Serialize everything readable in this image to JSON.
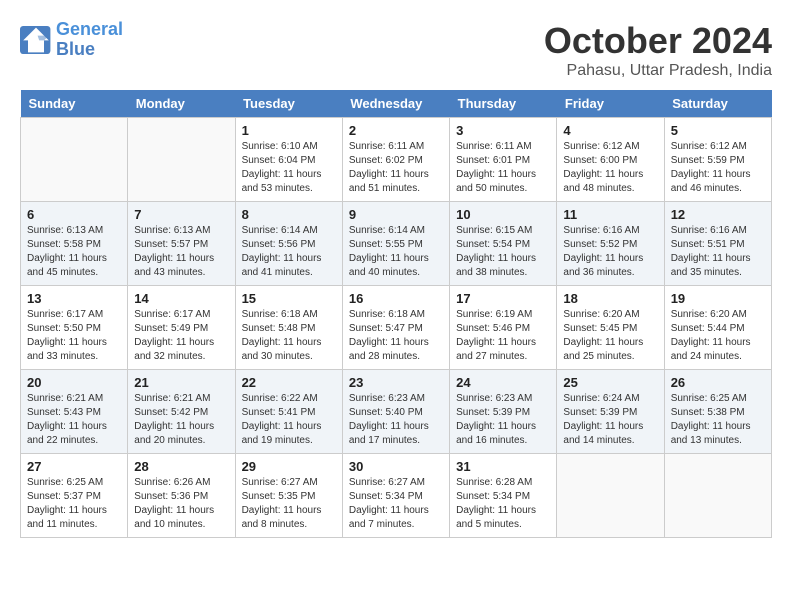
{
  "logo": {
    "line1": "General",
    "line2": "Blue"
  },
  "title": "October 2024",
  "subtitle": "Pahasu, Uttar Pradesh, India",
  "days_header": [
    "Sunday",
    "Monday",
    "Tuesday",
    "Wednesday",
    "Thursday",
    "Friday",
    "Saturday"
  ],
  "weeks": [
    [
      {
        "num": "",
        "info": ""
      },
      {
        "num": "",
        "info": ""
      },
      {
        "num": "1",
        "info": "Sunrise: 6:10 AM\nSunset: 6:04 PM\nDaylight: 11 hours and 53 minutes."
      },
      {
        "num": "2",
        "info": "Sunrise: 6:11 AM\nSunset: 6:02 PM\nDaylight: 11 hours and 51 minutes."
      },
      {
        "num": "3",
        "info": "Sunrise: 6:11 AM\nSunset: 6:01 PM\nDaylight: 11 hours and 50 minutes."
      },
      {
        "num": "4",
        "info": "Sunrise: 6:12 AM\nSunset: 6:00 PM\nDaylight: 11 hours and 48 minutes."
      },
      {
        "num": "5",
        "info": "Sunrise: 6:12 AM\nSunset: 5:59 PM\nDaylight: 11 hours and 46 minutes."
      }
    ],
    [
      {
        "num": "6",
        "info": "Sunrise: 6:13 AM\nSunset: 5:58 PM\nDaylight: 11 hours and 45 minutes."
      },
      {
        "num": "7",
        "info": "Sunrise: 6:13 AM\nSunset: 5:57 PM\nDaylight: 11 hours and 43 minutes."
      },
      {
        "num": "8",
        "info": "Sunrise: 6:14 AM\nSunset: 5:56 PM\nDaylight: 11 hours and 41 minutes."
      },
      {
        "num": "9",
        "info": "Sunrise: 6:14 AM\nSunset: 5:55 PM\nDaylight: 11 hours and 40 minutes."
      },
      {
        "num": "10",
        "info": "Sunrise: 6:15 AM\nSunset: 5:54 PM\nDaylight: 11 hours and 38 minutes."
      },
      {
        "num": "11",
        "info": "Sunrise: 6:16 AM\nSunset: 5:52 PM\nDaylight: 11 hours and 36 minutes."
      },
      {
        "num": "12",
        "info": "Sunrise: 6:16 AM\nSunset: 5:51 PM\nDaylight: 11 hours and 35 minutes."
      }
    ],
    [
      {
        "num": "13",
        "info": "Sunrise: 6:17 AM\nSunset: 5:50 PM\nDaylight: 11 hours and 33 minutes."
      },
      {
        "num": "14",
        "info": "Sunrise: 6:17 AM\nSunset: 5:49 PM\nDaylight: 11 hours and 32 minutes."
      },
      {
        "num": "15",
        "info": "Sunrise: 6:18 AM\nSunset: 5:48 PM\nDaylight: 11 hours and 30 minutes."
      },
      {
        "num": "16",
        "info": "Sunrise: 6:18 AM\nSunset: 5:47 PM\nDaylight: 11 hours and 28 minutes."
      },
      {
        "num": "17",
        "info": "Sunrise: 6:19 AM\nSunset: 5:46 PM\nDaylight: 11 hours and 27 minutes."
      },
      {
        "num": "18",
        "info": "Sunrise: 6:20 AM\nSunset: 5:45 PM\nDaylight: 11 hours and 25 minutes."
      },
      {
        "num": "19",
        "info": "Sunrise: 6:20 AM\nSunset: 5:44 PM\nDaylight: 11 hours and 24 minutes."
      }
    ],
    [
      {
        "num": "20",
        "info": "Sunrise: 6:21 AM\nSunset: 5:43 PM\nDaylight: 11 hours and 22 minutes."
      },
      {
        "num": "21",
        "info": "Sunrise: 6:21 AM\nSunset: 5:42 PM\nDaylight: 11 hours and 20 minutes."
      },
      {
        "num": "22",
        "info": "Sunrise: 6:22 AM\nSunset: 5:41 PM\nDaylight: 11 hours and 19 minutes."
      },
      {
        "num": "23",
        "info": "Sunrise: 6:23 AM\nSunset: 5:40 PM\nDaylight: 11 hours and 17 minutes."
      },
      {
        "num": "24",
        "info": "Sunrise: 6:23 AM\nSunset: 5:39 PM\nDaylight: 11 hours and 16 minutes."
      },
      {
        "num": "25",
        "info": "Sunrise: 6:24 AM\nSunset: 5:39 PM\nDaylight: 11 hours and 14 minutes."
      },
      {
        "num": "26",
        "info": "Sunrise: 6:25 AM\nSunset: 5:38 PM\nDaylight: 11 hours and 13 minutes."
      }
    ],
    [
      {
        "num": "27",
        "info": "Sunrise: 6:25 AM\nSunset: 5:37 PM\nDaylight: 11 hours and 11 minutes."
      },
      {
        "num": "28",
        "info": "Sunrise: 6:26 AM\nSunset: 5:36 PM\nDaylight: 11 hours and 10 minutes."
      },
      {
        "num": "29",
        "info": "Sunrise: 6:27 AM\nSunset: 5:35 PM\nDaylight: 11 hours and 8 minutes."
      },
      {
        "num": "30",
        "info": "Sunrise: 6:27 AM\nSunset: 5:34 PM\nDaylight: 11 hours and 7 minutes."
      },
      {
        "num": "31",
        "info": "Sunrise: 6:28 AM\nSunset: 5:34 PM\nDaylight: 11 hours and 5 minutes."
      },
      {
        "num": "",
        "info": ""
      },
      {
        "num": "",
        "info": ""
      }
    ]
  ]
}
